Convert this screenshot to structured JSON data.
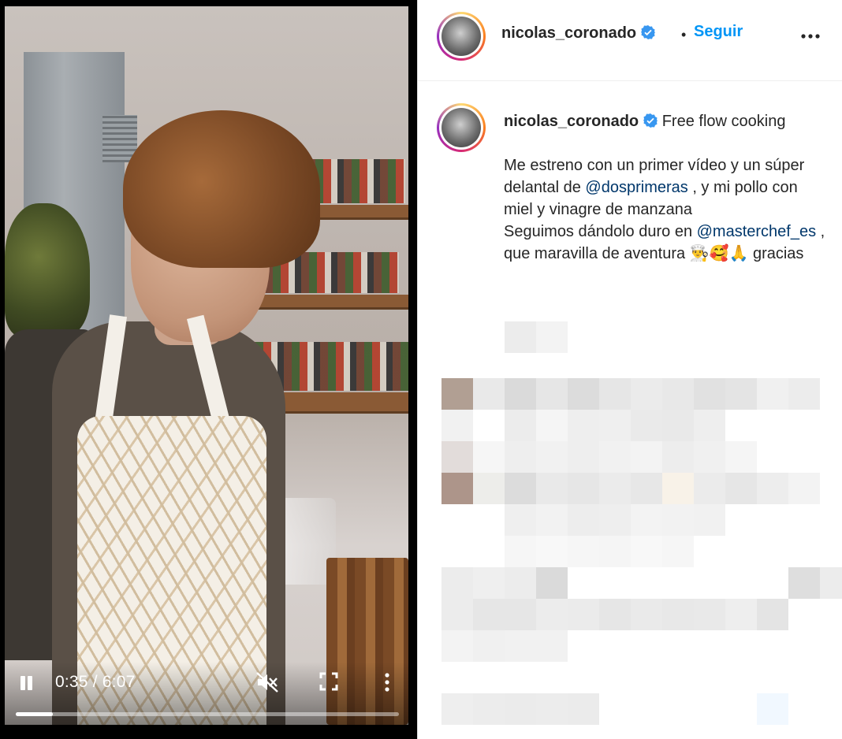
{
  "player": {
    "time_current": "0:35",
    "time_sep": " / ",
    "time_total": "6:07",
    "progress_fraction": 0.097,
    "muted": true,
    "playing": true
  },
  "post": {
    "username": "nicolas_coronado",
    "verified": true,
    "follow_label": "Seguir",
    "separator": "•"
  },
  "caption": {
    "username": "nicolas_coronado",
    "line1": " Free flow cooking",
    "part1": "\n\nMe estreno con un primer vídeo y un súper delantal de ",
    "mention1": "@dosprimeras",
    "part2": " , y mi pollo con miel y vinagre de manzana\nSeguimos dándolo duro en ",
    "mention2": "@masterchef_es",
    "part3": " , que maravilla de aventura 👨‍🍳🥰🙏 gracias"
  },
  "colors": {
    "accent": "#0095f6",
    "mention": "#00376b",
    "verified": "#3897f0",
    "text": "#262626"
  },
  "icons": {
    "pause": "pause-icon",
    "mute": "volume-muted-icon",
    "fullscreen": "fullscreen-icon",
    "more_vertical": "more-vertical-icon",
    "more_horizontal": "more-horizontal-icon",
    "verified": "verified-badge-icon"
  }
}
